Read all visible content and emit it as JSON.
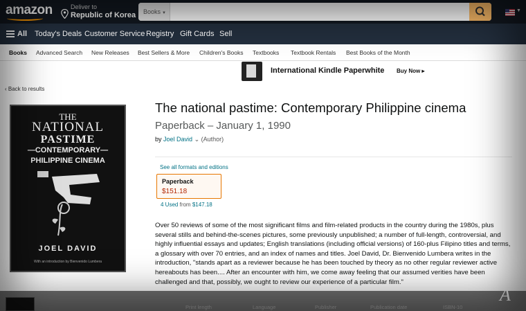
{
  "header": {
    "logo_text": "amazon",
    "deliver_label": "Deliver to",
    "deliver_location": "Republic of Korea",
    "search_category": "Books",
    "search_value": ""
  },
  "nav": {
    "all_label": "All",
    "items": [
      "Today's Deals",
      "Customer Service",
      "Registry",
      "Gift Cards",
      "Sell"
    ]
  },
  "subnav": {
    "items": [
      "Books",
      "Advanced Search",
      "New Releases",
      "Best Sellers & More",
      "Children's Books",
      "Textbooks",
      "Textbook Rentals",
      "Best Books of the Month"
    ]
  },
  "banner": {
    "text": "International Kindle Paperwhite",
    "cta": "Buy Now ▸"
  },
  "back_link": "‹ Back to results",
  "cover": {
    "line1": "THE",
    "line2": "NATIONAL",
    "line3": "PASTIME",
    "line4": "—CONTEMPORARY—",
    "line5": "PHILIPPINE CINEMA",
    "author": "JOEL DAVID",
    "intro": "With an introduction by Bienvenido Lumbera"
  },
  "product": {
    "title": "The national pastime: Contemporary Philippine cinema",
    "format_date": "Paperback – January 1, 1990",
    "by": "by",
    "author": "Joel David",
    "author_role": "(Author)",
    "see_all": "See all formats and editions",
    "format_name": "Paperback",
    "format_price": "$151.18",
    "used_count": "4 Used",
    "used_from": "from",
    "used_price": "$147.18",
    "description": "Over 50 reviews of some of the most significant films and film-related products in the country during the 1980s, plus several stills and behind-the-scenes pictures, some previously unpublished; a number of full-length, controversial, and highly influential essays and updates; English translations (including official versions) of 160-plus Filipino titles and terms, a glossary with over 70 entries, and an index of names and titles. Joel David, Dr. Bienvenido Lumbera writes in the introduction, \"stands apart as a reviewer because he has been touched by theory as no other regular reviewer active hereabouts has been.... After an encounter with him, we come away feeling that our assumed verities have been challenged and that, possibly, we ought to review our experience of a particular film.\""
  },
  "bottom": {
    "labels": [
      "Print length",
      "Language",
      "Publisher",
      "Publication date",
      "ISBN-10"
    ]
  },
  "watermark": "Á",
  "colors": {
    "nav_top": "#131921",
    "nav_main": "#232f3e",
    "accent": "#ff9900",
    "link": "#007185",
    "price": "#b12704",
    "format_border": "#e77600"
  }
}
